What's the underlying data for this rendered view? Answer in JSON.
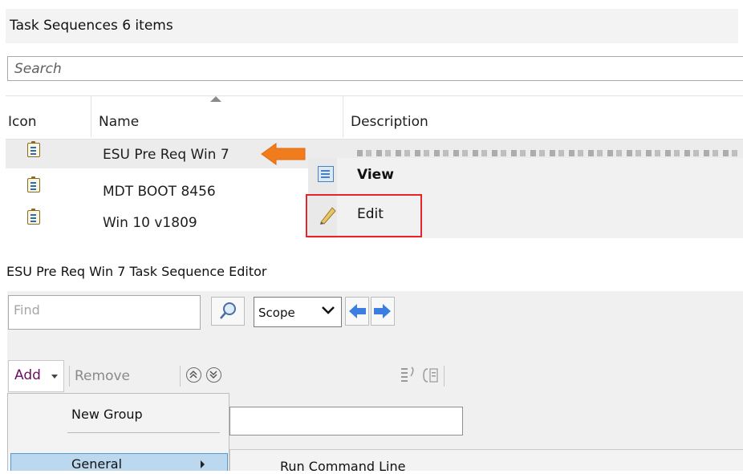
{
  "task_sequences": {
    "title": "Task Sequences 6 items",
    "search_placeholder": "Search",
    "columns": {
      "icon": "Icon",
      "name": "Name",
      "description": "Description"
    },
    "rows": [
      {
        "name": "ESU Pre Req Win 7"
      },
      {
        "name": "MDT BOOT 8456"
      },
      {
        "name": "Win 10 v1809"
      }
    ],
    "context_menu": {
      "view": "View",
      "edit": "Edit"
    }
  },
  "editor": {
    "title": "ESU Pre Req Win 7 Task Sequence Editor",
    "find_placeholder": "Find",
    "scope": "Scope",
    "add": "Add",
    "remove": "Remove",
    "add_menu": {
      "new_group": "New Group",
      "general": "General"
    },
    "general_submenu": {
      "run_command_line": "Run Command Line"
    }
  },
  "colors": {
    "highlight_box": "#e8232a",
    "arrow": "#f07c1e",
    "nav_arrow": "#3b7de0",
    "menu_selected": "#bcd8ef"
  },
  "icons": [
    "task-sequence-icon",
    "view-icon",
    "pencil-icon",
    "search-icon",
    "chevron-down-icon",
    "back-arrow-icon",
    "forward-arrow-icon",
    "move-up-icon",
    "move-down-icon",
    "arrow-left-icon"
  ]
}
